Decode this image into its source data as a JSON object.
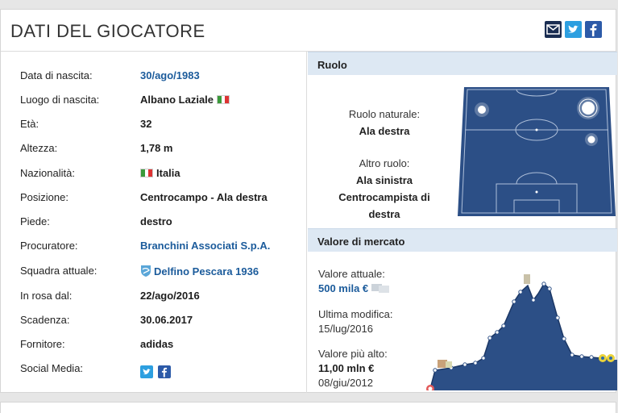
{
  "header": {
    "title": "DATI DEL GIOCATORE"
  },
  "share": {
    "mail_icon": "envelope-icon",
    "twitter_icon": "twitter-icon",
    "facebook_icon": "facebook-icon"
  },
  "details": [
    {
      "label": "Data di nascita:",
      "value": "30/ago/1983",
      "link": true
    },
    {
      "label": "Luogo di nascita:",
      "value": "Albano Laziale",
      "flag": "italy"
    },
    {
      "label": "Età:",
      "value": "32"
    },
    {
      "label": "Altezza:",
      "value": "1,78 m"
    },
    {
      "label": "Nazionalità:",
      "value": "Italia",
      "flag_before": "italy"
    },
    {
      "label": "Posizione:",
      "value": "Centrocampo - Ala destra"
    },
    {
      "label": "Piede:",
      "value": "destro"
    },
    {
      "label": "Procuratore:",
      "value": "Branchini Associati S.p.A.",
      "link": true
    },
    {
      "label": "Squadra attuale:",
      "value": "Delfino Pescara 1936",
      "link": true,
      "club_icon": true
    },
    {
      "label": "In rosa dal:",
      "value": "22/ago/2016"
    },
    {
      "label": "Scadenza:",
      "value": "30.06.2017"
    },
    {
      "label": "Fornitore:",
      "value": "adidas"
    },
    {
      "label": "Social Media:",
      "value": ""
    }
  ],
  "role": {
    "heading": "Ruolo",
    "natural_label": "Ruolo naturale:",
    "natural_value": "Ala destra",
    "other_label": "Altro ruolo:",
    "other_values": [
      "Ala sinistra",
      "Centrocampista di",
      "destra"
    ]
  },
  "market": {
    "heading": "Valore di mercato",
    "current_label": "Valore attuale:",
    "current_value": "500 mila €",
    "last_change_label": "Ultima modifica:",
    "last_change_date": "15/lug/2016",
    "highest_label": "Valore più alto:",
    "highest_value": "11,00 mln €",
    "highest_date": "08/giu/2012"
  },
  "colors": {
    "link": "#1b5b9b",
    "pitch": "#2c4f86",
    "section_head": "#dde8f3",
    "chart_fill": "#2c4f86"
  }
}
